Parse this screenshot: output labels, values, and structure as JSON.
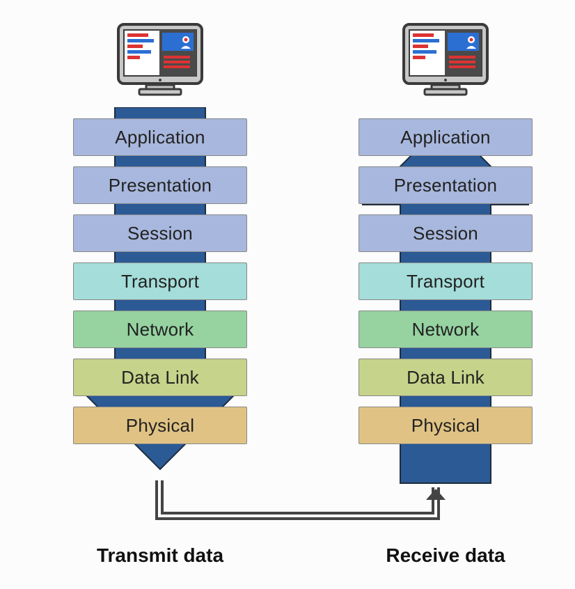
{
  "colors": {
    "arrow_fill": "#2b5a95",
    "arrow_stroke": "#1d2d3d",
    "connector": "#444444",
    "layers": {
      "application": "#a8b7dd",
      "presentation": "#a8b7dd",
      "session": "#a8b7dd",
      "transport": "#a4ddd9",
      "network": "#96d3a1",
      "datalink": "#c6d38a",
      "physical": "#e0c384"
    }
  },
  "layers": [
    {
      "key": "application",
      "label": "Application"
    },
    {
      "key": "presentation",
      "label": "Presentation"
    },
    {
      "key": "session",
      "label": "Session"
    },
    {
      "key": "transport",
      "label": "Transport"
    },
    {
      "key": "network",
      "label": "Network"
    },
    {
      "key": "datalink",
      "label": "Data Link"
    },
    {
      "key": "physical",
      "label": "Physical"
    }
  ],
  "columns": {
    "left": {
      "caption": "Transmit data",
      "direction": "down"
    },
    "right": {
      "caption": "Receive data",
      "direction": "up"
    }
  }
}
